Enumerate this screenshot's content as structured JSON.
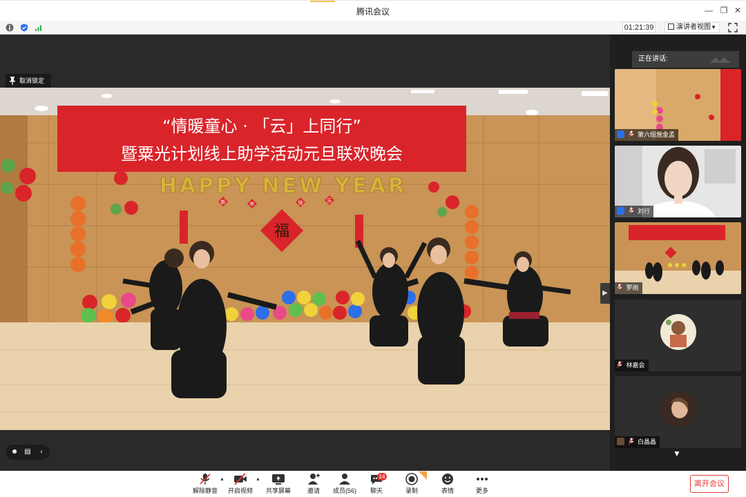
{
  "window": {
    "title": "腾讯会议"
  },
  "infobar": {
    "timer": "01:21:39",
    "view_mode": "演讲者视图"
  },
  "stage": {
    "unlock_label": "取消锁定",
    "banner_line1": "“情暖童心 · 「云」上同行”",
    "banner_line2": "暨粟光计划线上助学活动元旦联欢晚会",
    "balloon_letters": "HAPPY NEW YEAR",
    "couplet_chars": [
      "新",
      "年",
      "快",
      "乐"
    ],
    "fu_char": "福"
  },
  "panel": {
    "speaking_label": "正在讲话:",
    "participants": [
      {
        "name": "第六组施金孟",
        "icon": "user-blue"
      },
      {
        "name": "刘行",
        "icon": "user-blue"
      },
      {
        "name": "罗雨",
        "icon": "user-brown"
      },
      {
        "name": "林嘉会",
        "icon": "user-brown"
      },
      {
        "name": "白晶晶",
        "icon": "user-brown"
      }
    ]
  },
  "toolbar": {
    "mute_label": "解除静音",
    "video_label": "开启视频",
    "share_label": "共享屏幕",
    "invite_label": "邀请",
    "members_label": "成员(56)",
    "chat_label": "聊天",
    "chat_badge": "14",
    "record_label": "录制",
    "emoji_label": "表情",
    "more_label": "更多",
    "leave_label": "离开会议"
  },
  "colors": {
    "accent_red": "#e53935",
    "panel_bg": "#1f1f1f",
    "badge_orange": "#f5a34a",
    "member_icon_blue": "#2d6fe8"
  }
}
